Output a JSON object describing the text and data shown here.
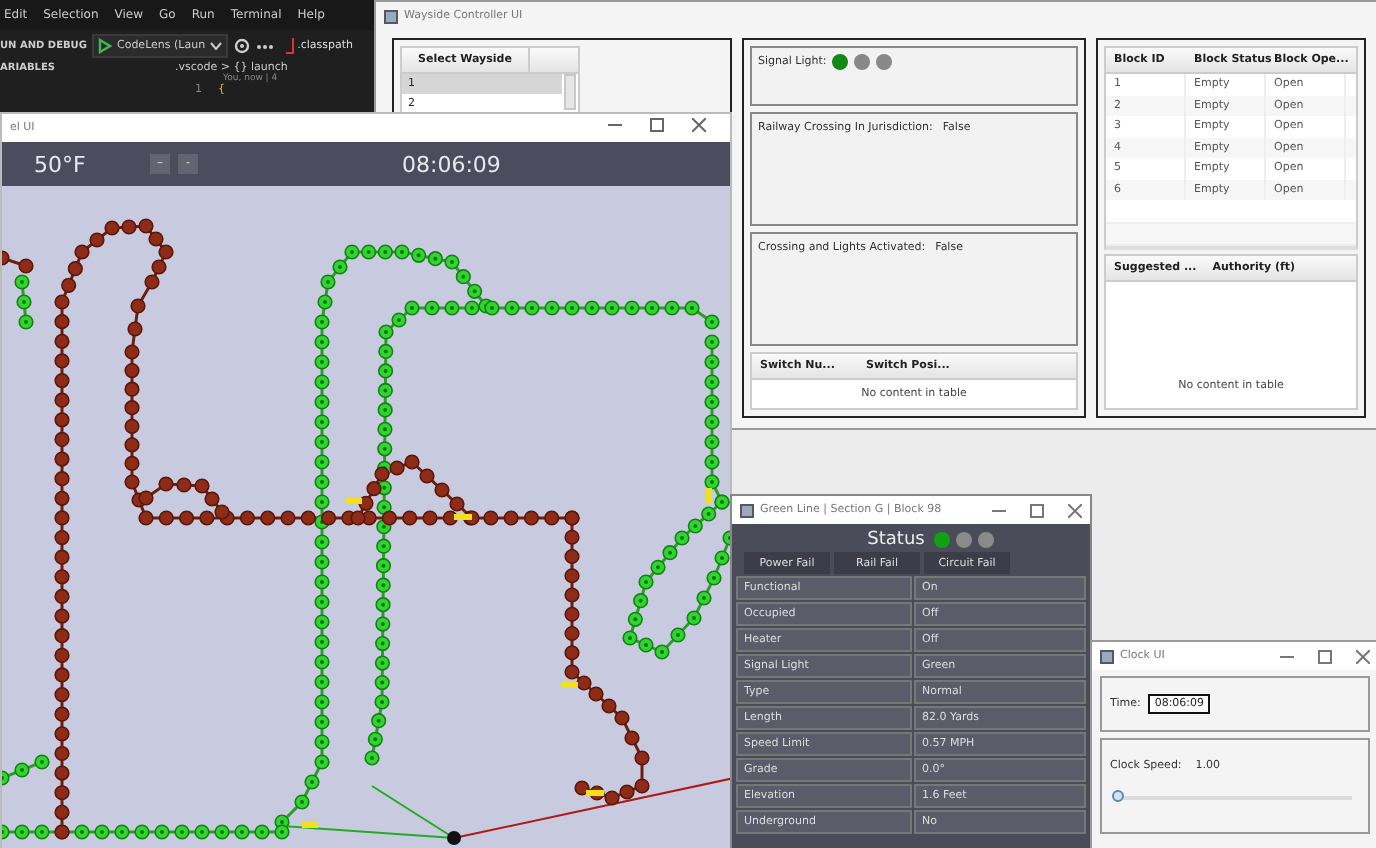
{
  "vscode": {
    "menu": [
      "Edit",
      "Selection",
      "View",
      "Go",
      "Run",
      "Terminal",
      "Help"
    ],
    "panel_title": "UN AND DEBUG",
    "run_config": "CodeLens (Laun",
    "section": "ARIABLES",
    "file_tab": ".classpath",
    "breadcrumb": ".vscode > {} launch",
    "blame": "You, now | 4",
    "line_number": "1",
    "code": "{"
  },
  "wayside": {
    "title": "Wayside Controller UI",
    "wayside_table": {
      "columns": [
        "Select Wayside"
      ],
      "rows": [
        {
          "cells": [
            "1"
          ],
          "selected": true
        },
        {
          "cells": [
            "2"
          ],
          "selected": false
        }
      ]
    },
    "signal_light": {
      "label": "Signal Light:",
      "lights": [
        {
          "on": true
        },
        {
          "on": false
        },
        {
          "on": false
        }
      ]
    },
    "railway_crossing": {
      "label": "Railway Crossing In Jurisdiction:",
      "value": "False"
    },
    "crossing_lights": {
      "label": "Crossing and Lights Activated:",
      "value": "False"
    },
    "switch_table": {
      "columns": [
        "Switch Nu...",
        "Switch Posi..."
      ],
      "empty_message": "No content in table"
    },
    "block_table": {
      "columns": [
        "Block ID",
        "Block Status",
        "Block Ope..."
      ],
      "rows": [
        [
          "1",
          "Empty",
          "Open"
        ],
        [
          "2",
          "Empty",
          "Open"
        ],
        [
          "3",
          "Empty",
          "Open"
        ],
        [
          "4",
          "Empty",
          "Open"
        ],
        [
          "5",
          "Empty",
          "Open"
        ],
        [
          "6",
          "Empty",
          "Open"
        ]
      ]
    },
    "authority_table": {
      "columns": [
        "Suggested ...",
        "Authority (ft)"
      ],
      "empty_message": "No content in table"
    }
  },
  "track_window": {
    "title": "el UI",
    "temperature": "50°F",
    "buttons": [
      "–",
      "-"
    ],
    "time": "08:06:09"
  },
  "block_window": {
    "title": "Green Line | Section G | Block 98",
    "status_label": "Status",
    "status_lights": [
      {
        "on": true
      },
      {
        "on": false
      },
      {
        "on": false
      }
    ],
    "failure_buttons": [
      "Power Fail",
      "Rail Fail",
      "Circuit Fail"
    ],
    "properties": [
      {
        "name": "Functional",
        "value": "On"
      },
      {
        "name": "Occupied",
        "value": "Off"
      },
      {
        "name": "Heater",
        "value": "Off"
      },
      {
        "name": "Signal Light",
        "value": "Green"
      },
      {
        "name": "Type",
        "value": "Normal"
      },
      {
        "name": "Length",
        "value": "82.0 Yards"
      },
      {
        "name": "Speed Limit",
        "value": "0.57 MPH"
      },
      {
        "name": "Grade",
        "value": "0.0°"
      },
      {
        "name": "Elevation",
        "value": "1.6 Feet"
      },
      {
        "name": "Underground",
        "value": "No"
      }
    ]
  },
  "clock": {
    "title": "Clock UI",
    "time_label": "Time:",
    "time": "08:06:09",
    "speed_label": "Clock Speed:",
    "speed": "1.00",
    "slider": {
      "level": 0
    }
  }
}
